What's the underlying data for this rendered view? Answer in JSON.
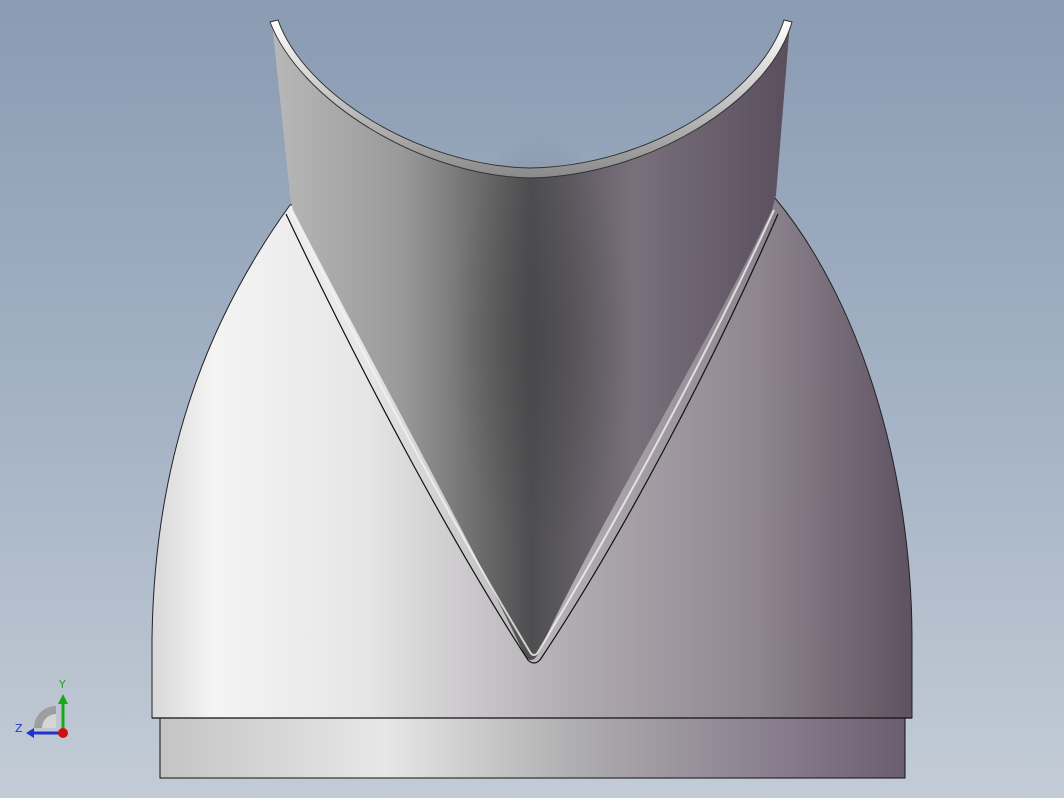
{
  "viewport": {
    "background_top": "#8a9bb2",
    "background_bottom": "#c3ccd6"
  },
  "triad": {
    "y_label": "Y",
    "z_label": "Z",
    "y_color": "#1aa81a",
    "z_color": "#2233cc",
    "x_color": "#d01010"
  },
  "model": {
    "edge_color": "#111111",
    "icon": "3d-part-model"
  }
}
